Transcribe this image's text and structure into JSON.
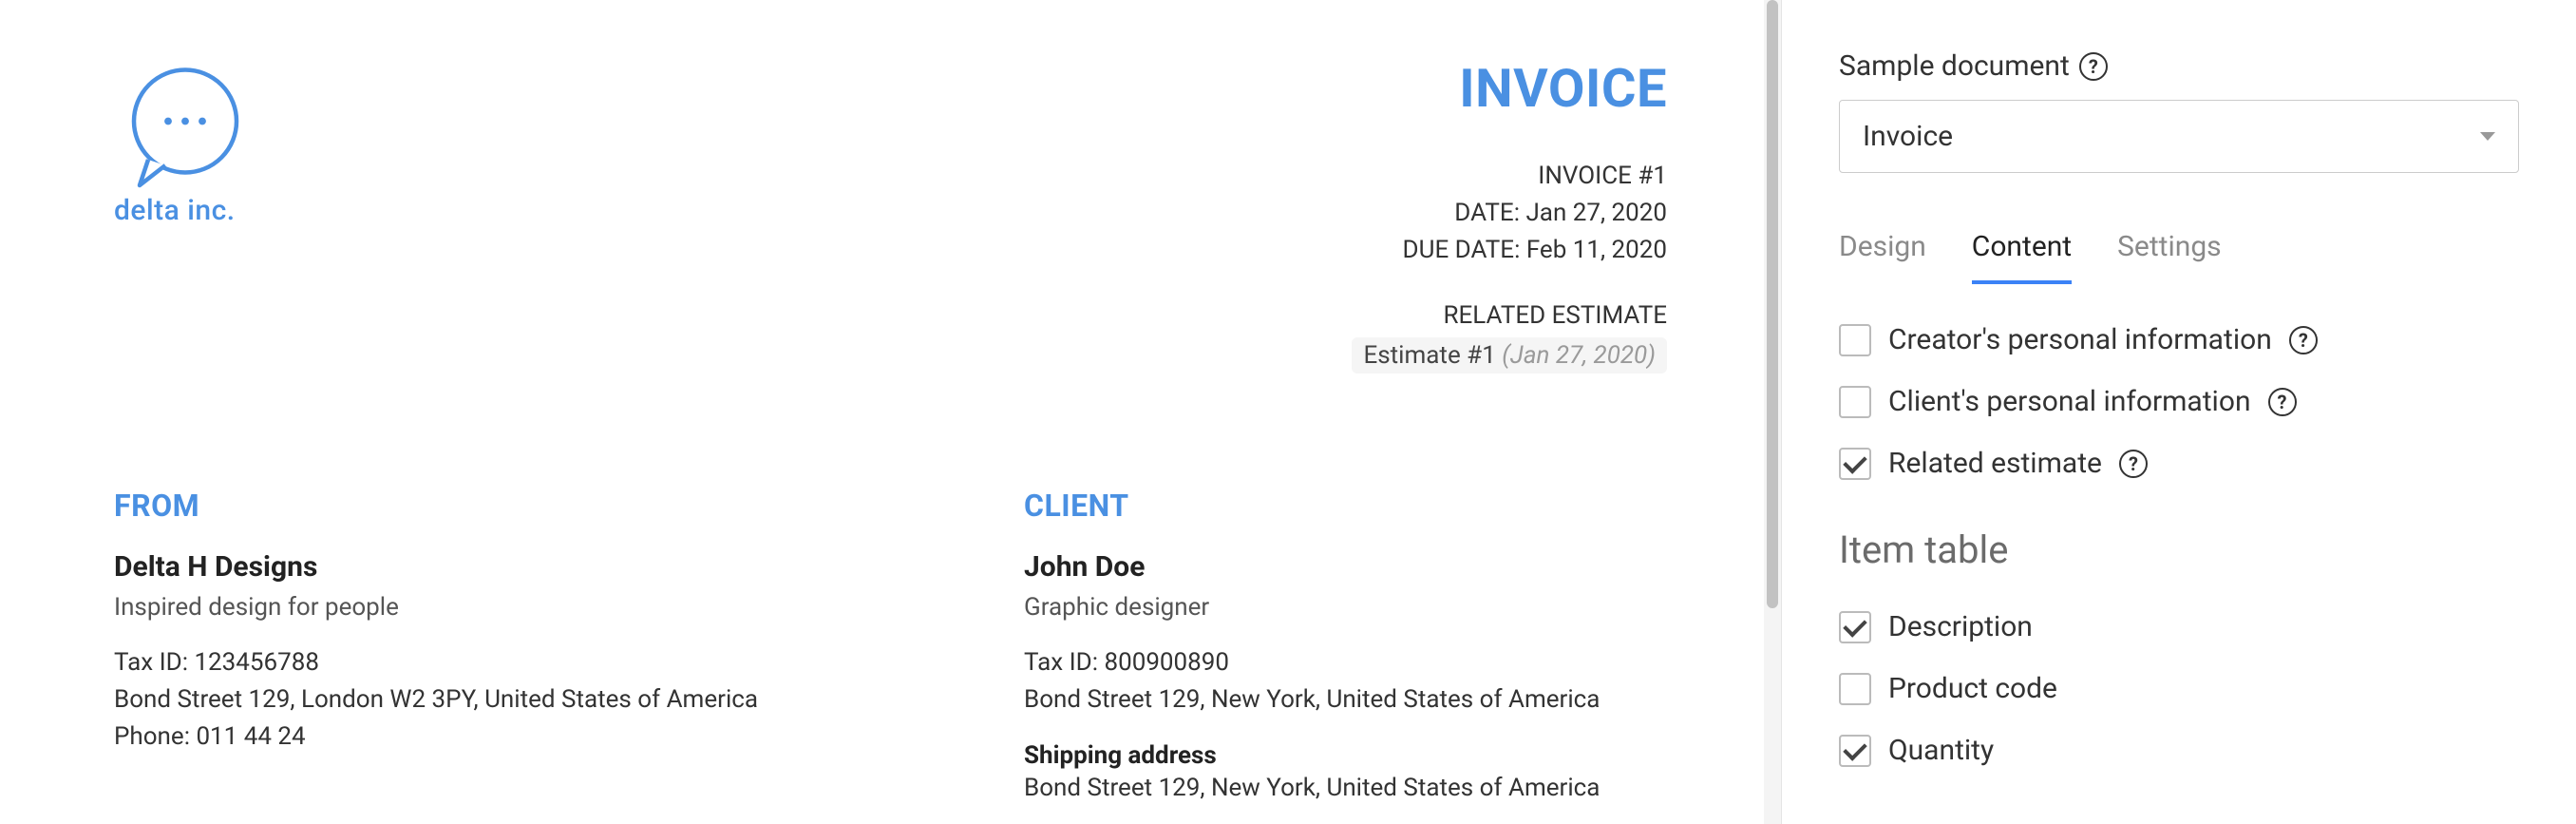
{
  "preview": {
    "logo_name": "delta inc.",
    "invoice_title": "INVOICE",
    "invoice_number": "INVOICE #1",
    "date": "DATE: Jan 27, 2020",
    "due_date": "DUE DATE: Feb 11, 2020",
    "related_estimate_label": "RELATED ESTIMATE",
    "related_chip_name": "Estimate #1",
    "related_chip_date": "(Jan 27, 2020)",
    "from": {
      "label": "FROM",
      "name": "Delta H Designs",
      "tagline": "Inspired design for people",
      "tax_id": "Tax ID: 123456788",
      "address": "Bond Street 129, London W2 3PY, United States of America",
      "phone": "Phone: 011 44 24"
    },
    "client": {
      "label": "CLIENT",
      "name": "John Doe",
      "role": "Graphic designer",
      "tax_id": "Tax ID: 800900890",
      "address": "Bond Street 129, New York, United States of America",
      "shipping_label": "Shipping address",
      "shipping_address": "Bond Street 129, New York, United States of America"
    }
  },
  "panel": {
    "sample_document_label": "Sample document",
    "sample_document_value": "Invoice",
    "tabs": {
      "design": "Design",
      "content": "Content",
      "settings": "Settings"
    },
    "checks": {
      "creator_info": "Creator's personal information",
      "client_info": "Client's personal information",
      "related_estimate": "Related estimate"
    },
    "item_table_heading": "Item table",
    "item_checks": {
      "description": "Description",
      "product_code": "Product code",
      "quantity": "Quantity"
    }
  }
}
